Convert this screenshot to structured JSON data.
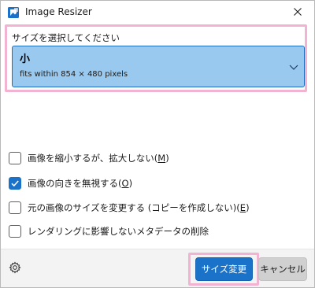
{
  "window": {
    "title": "Image Resizer",
    "icon": "image-resizer-app-icon",
    "close_icon": "close-icon"
  },
  "size": {
    "label": "サイズを選択してください",
    "selected_name": "小",
    "selected_desc": "fits within 854 × 480 pixels",
    "chevron_icon": "chevron-down-icon",
    "accent_color": "#99c9ef",
    "border_color": "#1f6fbf"
  },
  "options": [
    {
      "label_main": "画像を縮小するが、拡大しない(",
      "accel": "M",
      "label_end": ")",
      "checked": false
    },
    {
      "label_main": "画像の向きを無視する(",
      "accel": "O",
      "label_end": ")",
      "checked": true
    },
    {
      "label_main": "元の画像のサイズを変更する (コピーを作成しない)(",
      "accel": "E",
      "label_end": ")",
      "checked": false
    },
    {
      "label_main": "レンダリングに影響しないメタデータの削除",
      "accel": "",
      "label_end": "",
      "checked": false
    }
  ],
  "footer": {
    "settings_icon": "gear-icon",
    "resize_label": "サイズ変更",
    "cancel_label": "キャンセル",
    "primary_color": "#1a73c8",
    "highlight_color": "#f2b3d2"
  }
}
